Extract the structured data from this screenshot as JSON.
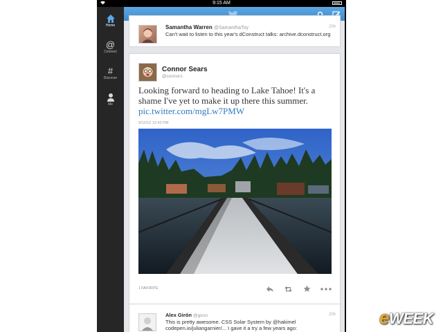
{
  "status_bar": {
    "time": "9:15 AM"
  },
  "sidebar": {
    "items": [
      {
        "label": "Home",
        "icon": "home-icon",
        "active": true
      },
      {
        "label": "Connect",
        "icon": "at-icon"
      },
      {
        "label": "Discover",
        "icon": "hash-icon"
      },
      {
        "label": "Me",
        "icon": "person-icon"
      }
    ]
  },
  "topbar": {
    "icons": [
      "twitter-bird-icon",
      "search-icon",
      "compose-icon"
    ],
    "color": "#4a99d9"
  },
  "tweets": [
    {
      "name": "Samantha Warren",
      "handle": "@SamanthaToy",
      "time": "20h",
      "text": "Can't wait to listen to this year's dConstruct talks: archive.dconstruct.org"
    },
    {
      "name": "Connor Sears",
      "handle": "@connors",
      "text_main": "Looking forward to heading to Lake Tahoe! It's a shame I've yet to make it up there this summer.",
      "link": "pic.twitter.com/mgLw7PMW",
      "timestamp": "9/12/12 12:42 PM",
      "favorites": "1 FAVORITE"
    },
    {
      "name": "Alex Girón",
      "handle": "@giron",
      "time": "20h",
      "line1": "This is pretty awesome. CSS Solar System by @hakimel",
      "line2": "codepen.io/juliangarnier/... I gave it a try a few years ago:"
    }
  ],
  "watermark": {
    "prefix": "e",
    "rest": "WEEK"
  }
}
